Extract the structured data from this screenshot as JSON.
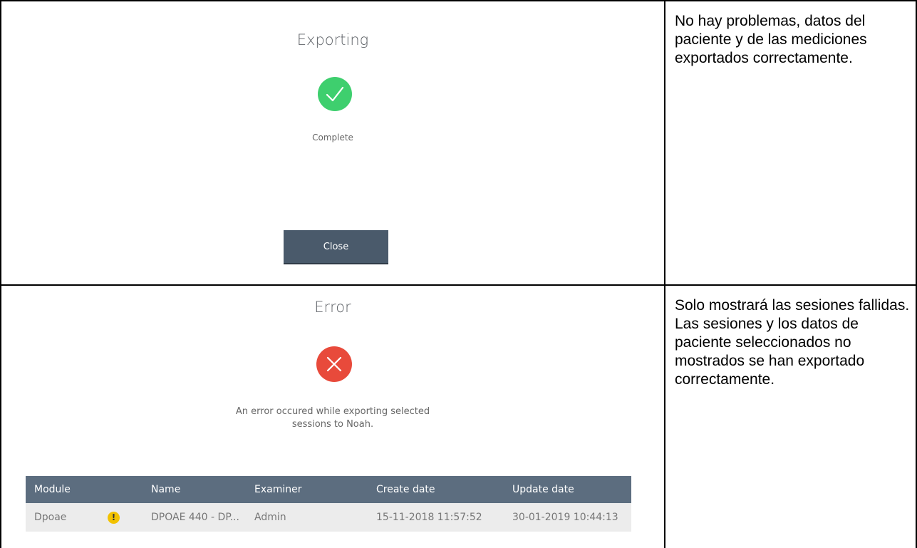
{
  "rows": [
    {
      "dialog": {
        "title": "Exporting",
        "status_icon": "check-icon",
        "status_color": "#3ecf6e",
        "message": "Complete",
        "close_label": "Close"
      },
      "description": "No hay problemas, datos del paciente y de las mediciones exportados correctamente."
    },
    {
      "dialog": {
        "title": "Error",
        "status_icon": "close-x-icon",
        "status_color": "#e84a3b",
        "message_line1": "An error occured while exporting selected",
        "message_line2": "sessions to Noah.",
        "table": {
          "headers": [
            "Module",
            "Name",
            "Examiner",
            "Create date",
            "Update date"
          ],
          "rows": [
            {
              "module": "Dpoae",
              "warning_icon": "warning-icon",
              "warning_color": "#f2c200",
              "warning_glyph": "!",
              "name": "DPOAE 440 - DP...",
              "examiner": "Admin",
              "create_date": "15-11-2018 11:57:52",
              "update_date": "30-01-2019 10:44:13"
            }
          ]
        }
      },
      "description": "Solo mostrará las sesiones fallidas. Las sesiones y los datos de paciente seleccionados no mostrados se han exportado correctamente."
    }
  ]
}
